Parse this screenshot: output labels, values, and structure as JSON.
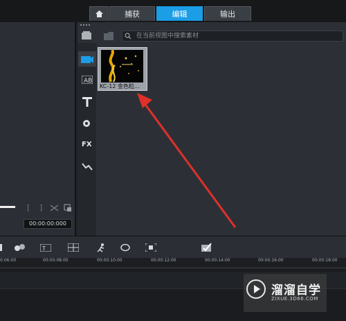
{
  "tabs": {
    "home_icon": "home-icon",
    "items": [
      {
        "label": "捕获"
      },
      {
        "label": "编辑"
      },
      {
        "label": "输出"
      }
    ],
    "active_color": "#1b9ee6"
  },
  "library": {
    "search_placeholder": "在当前视图中搜索素材",
    "thumbnail": {
      "caption": "KC-12 金色粒..."
    },
    "side_icons": [
      "media-icon",
      "transition-icon",
      "title-icon",
      "graphic-icon",
      "filter-icon",
      "path-icon"
    ]
  },
  "preview": {
    "timecode": "00:00:00:000",
    "mark_in": "[",
    "mark_out": "]"
  },
  "timeline": {
    "ticks": [
      "0:06:00",
      "00:00:08:00",
      "00:00:10:00",
      "00:00:12:00",
      "00:00:14:00",
      "00:00:16:00",
      "00:00:18:00"
    ]
  },
  "watermark": {
    "title": "溜溜自学",
    "subtitle": "ZIXUE.3D66.COM"
  },
  "annotation": {
    "arrow_color": "#e0302a"
  }
}
